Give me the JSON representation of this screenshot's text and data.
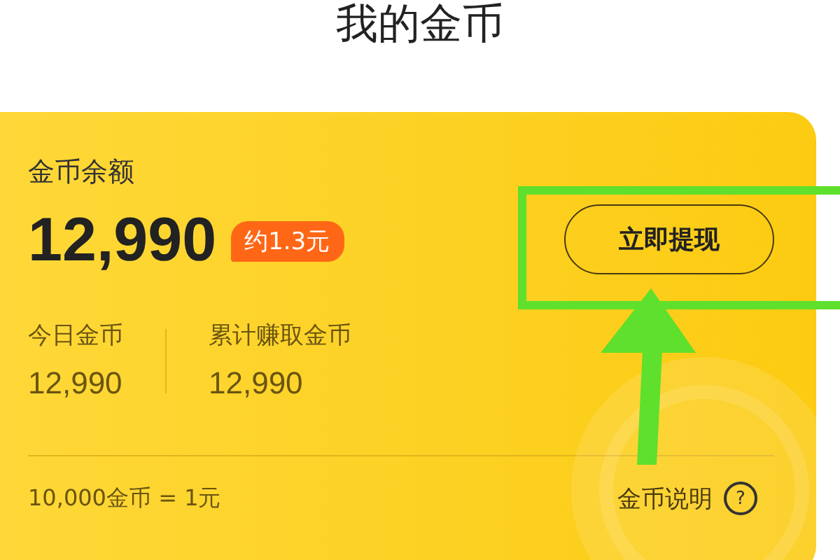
{
  "title": "我的金币",
  "balance": {
    "label": "金币余额",
    "amount": "12,990",
    "badge": "约1.3元"
  },
  "withdraw_button": "立即提现",
  "stats": [
    {
      "label": "今日金币",
      "value": "12,990"
    },
    {
      "label": "累计赚取金币",
      "value": "12,990"
    }
  ],
  "rate_text": "10,000金币 = 1元",
  "help_link": {
    "label": "金币说明",
    "icon": "?"
  }
}
